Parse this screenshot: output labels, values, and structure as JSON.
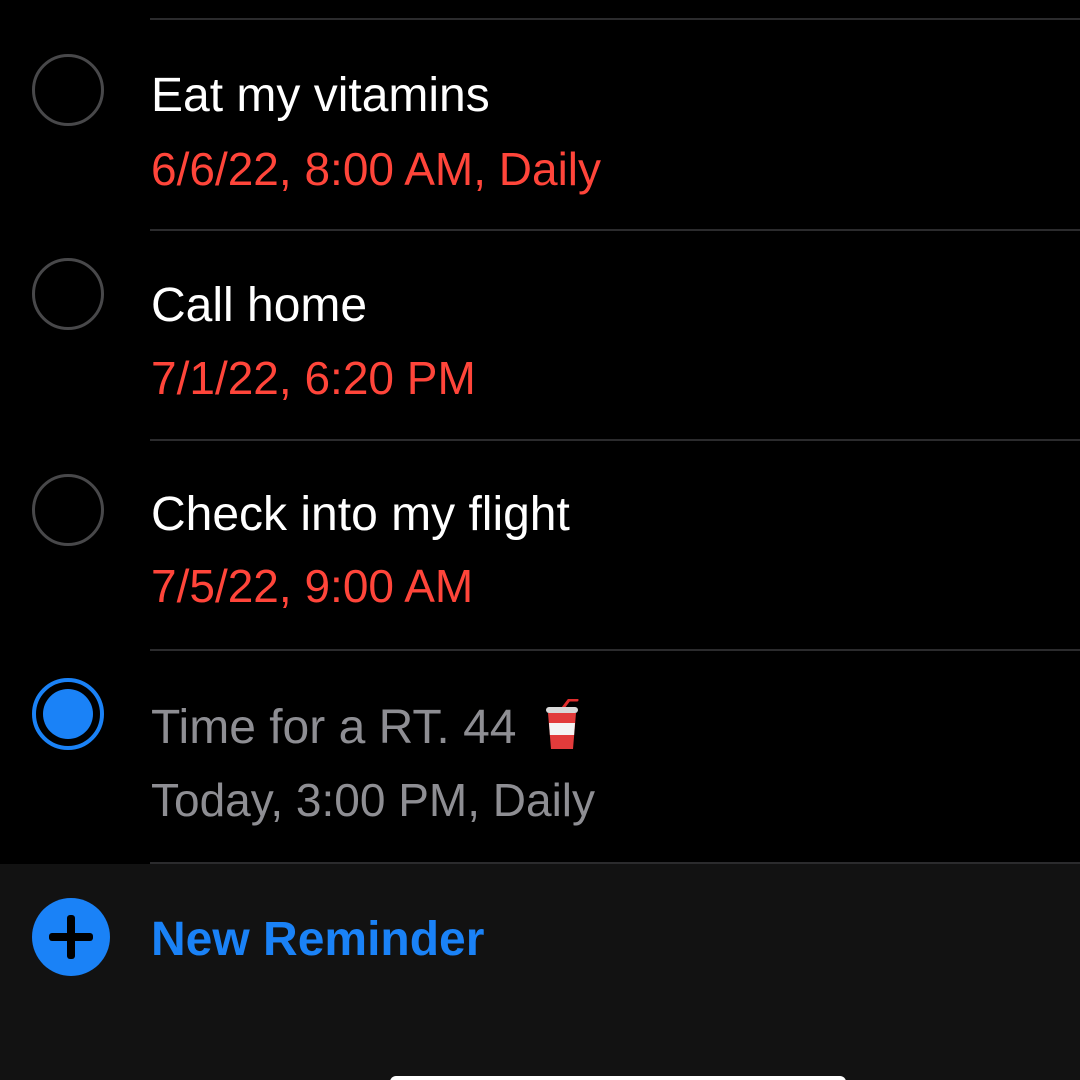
{
  "reminders": [
    {
      "title": "Eat my vitamins",
      "due": "6/6/22, 8:00 AM, Daily",
      "completed": false
    },
    {
      "title": "Call home",
      "due": "7/1/22, 6:20 PM",
      "completed": false
    },
    {
      "title": "Check into my flight",
      "due": "7/5/22, 9:00 AM",
      "completed": false
    },
    {
      "title": "Time for a RT. 44",
      "title_icon": "soda-cup-icon",
      "due": "Today, 3:00 PM, Daily",
      "completed": true
    }
  ],
  "footer": {
    "new_reminder_label": "New Reminder",
    "add_icon": "plus-circle-icon"
  },
  "colors": {
    "background": "#000000",
    "footer_background": "#121212",
    "accent_blue": "#1a82f7",
    "overdue_red": "#ff453a",
    "completed_gray": "#8e8e93",
    "separator": "#2b2b2d"
  }
}
